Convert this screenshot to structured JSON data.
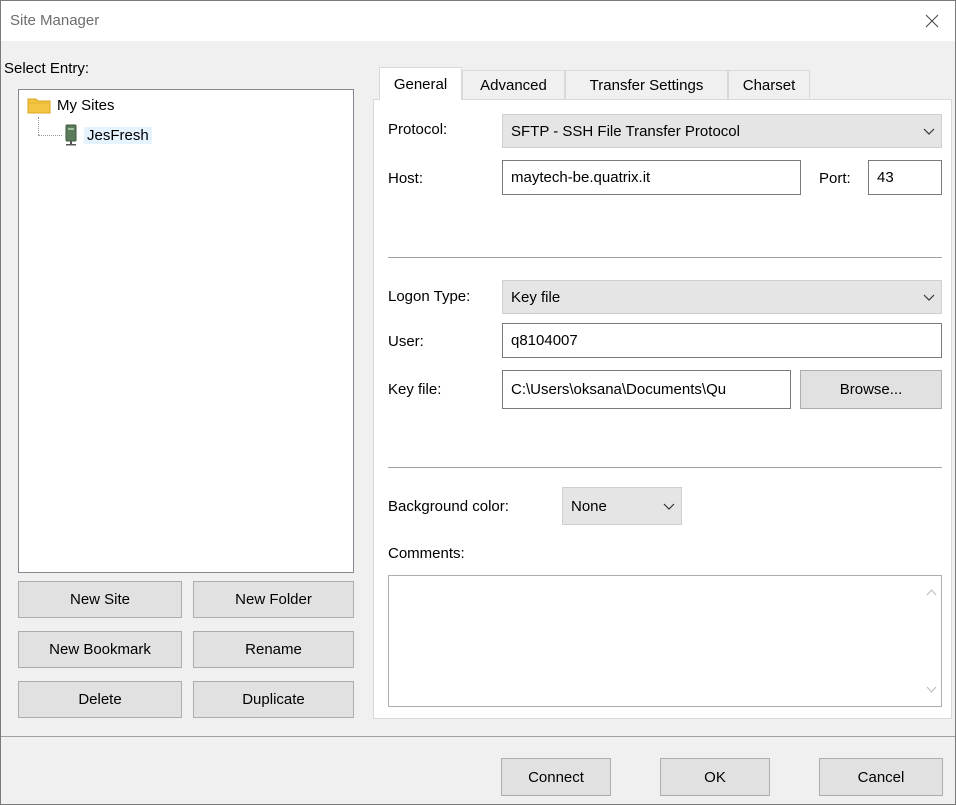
{
  "window": {
    "title": "Site Manager"
  },
  "left": {
    "select_entry_label": "Select Entry:",
    "tree": {
      "root": "My Sites",
      "site": "JesFresh"
    },
    "buttons": {
      "new_site": "New Site",
      "new_folder": "New Folder",
      "new_bookmark": "New Bookmark",
      "rename": "Rename",
      "delete": "Delete",
      "duplicate": "Duplicate"
    }
  },
  "tabs": [
    "General",
    "Advanced",
    "Transfer Settings",
    "Charset"
  ],
  "general": {
    "protocol_label": "Protocol:",
    "protocol_value": "SFTP - SSH File Transfer Protocol",
    "host_label": "Host:",
    "host_value": "maytech-be.quatrix.it",
    "port_label": "Port:",
    "port_value": "43",
    "logon_type_label": "Logon Type:",
    "logon_type_value": "Key file",
    "user_label": "User:",
    "user_value": "q8104007",
    "key_file_label": "Key file:",
    "key_file_value": "C:\\Users\\oksana\\Documents\\Qu",
    "browse_label": "Browse...",
    "background_color_label": "Background color:",
    "background_color_value": "None",
    "comments_label": "Comments:",
    "comments_value": ""
  },
  "footer": {
    "connect": "Connect",
    "ok": "OK",
    "cancel": "Cancel"
  },
  "icons": {
    "close": "close-icon",
    "folder": "folder-icon",
    "server": "server-icon",
    "chevron": "chevron-down-icon"
  },
  "colors": {
    "folder": "#f4c542",
    "selection": "#e5f3ff",
    "window_bg": "#f0f0f0"
  }
}
